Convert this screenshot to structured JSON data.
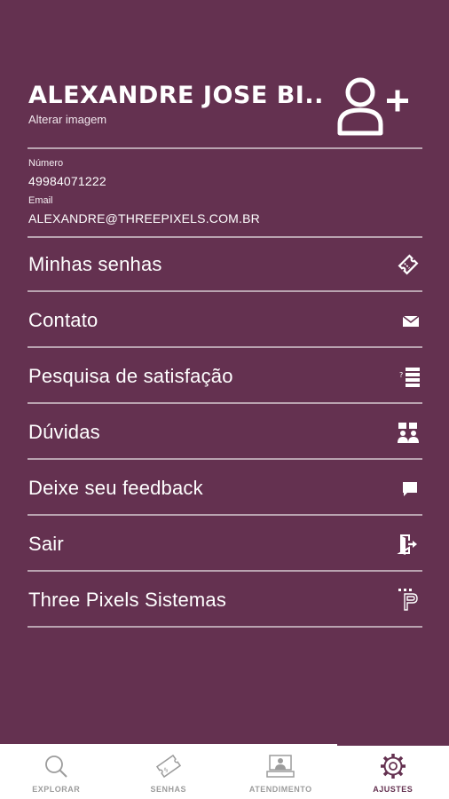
{
  "profile": {
    "name": "ALEXANDRE JOSE BI...",
    "change_image": "Alterar imagem"
  },
  "info": {
    "number_label": "Número",
    "number_value": "49984071222",
    "email_label": "Email",
    "email_value": "ALEXANDRE@THREEPIXELS.COM.BR"
  },
  "menu": [
    {
      "label": "Minhas senhas",
      "icon": "ticket-icon"
    },
    {
      "label": "Contato",
      "icon": "envelope-icon"
    },
    {
      "label": "Pesquisa de satisfação",
      "icon": "survey-list-icon"
    },
    {
      "label": "Dúvidas",
      "icon": "faq-people-icon"
    },
    {
      "label": "Deixe seu feedback",
      "icon": "chat-bubble-icon"
    },
    {
      "label": "Sair",
      "icon": "exit-door-icon"
    },
    {
      "label": "Three Pixels Sistemas",
      "icon": "threepixels-logo-icon"
    }
  ],
  "tabs": [
    {
      "label": "EXPLORAR",
      "icon": "search-icon",
      "active": false
    },
    {
      "label": "SENHAS",
      "icon": "ticket-icon",
      "active": false
    },
    {
      "label": "ATENDIMENTO",
      "icon": "service-desk-icon",
      "active": false
    },
    {
      "label": "AJUSTES",
      "icon": "gear-icon",
      "active": true
    }
  ],
  "colors": {
    "background": "#643150",
    "divider": "#b9a3b0",
    "tab_inactive": "#9c9c9c"
  }
}
